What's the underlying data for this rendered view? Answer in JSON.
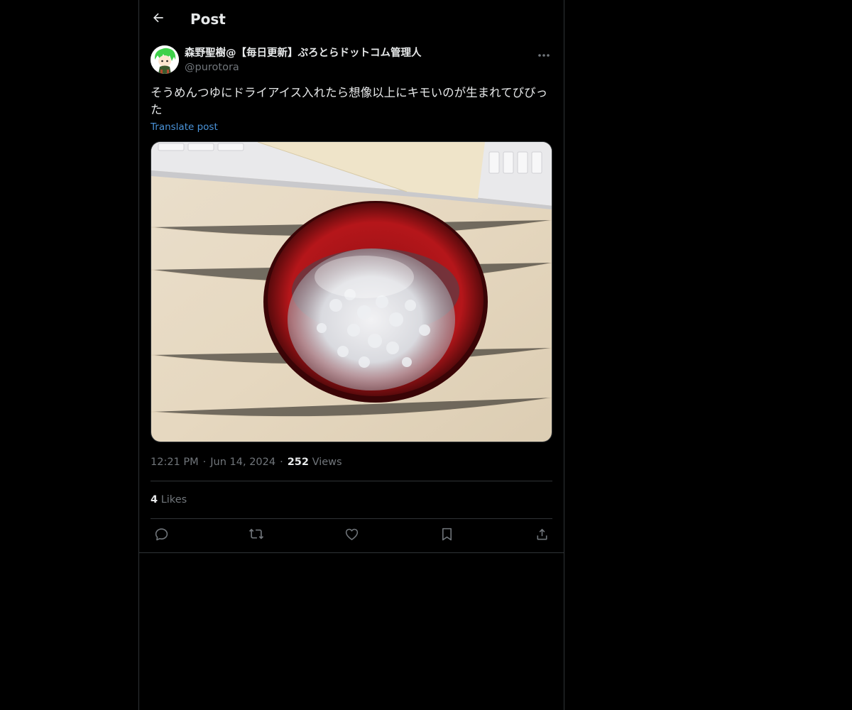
{
  "header": {
    "title": "Post",
    "back_icon": "arrow-left-icon"
  },
  "author": {
    "display_name": "森野聖樹@【毎日更新】ぷろとらドットコム管理人",
    "handle": "@purotora",
    "more_icon": "more-horizontal-icon"
  },
  "post": {
    "text": "そうめんつゆにドライアイス入れたら想像以上にキモいのが生まれてびびった",
    "translate_label": "Translate post"
  },
  "meta": {
    "time": "12:21 PM",
    "date": "Jun 14, 2024",
    "views_count": "252",
    "views_label": "Views"
  },
  "engagement": {
    "likes_count": "4",
    "likes_label": "Likes"
  },
  "actions": [
    {
      "icon": "reply-icon"
    },
    {
      "icon": "repost-icon"
    },
    {
      "icon": "like-icon"
    },
    {
      "icon": "bookmark-icon"
    },
    {
      "icon": "share-icon"
    }
  ],
  "colors": {
    "background": "#000000",
    "text": "#e7e9ea",
    "muted": "#71767b",
    "link": "#4a93d9",
    "border": "#2f3336"
  }
}
